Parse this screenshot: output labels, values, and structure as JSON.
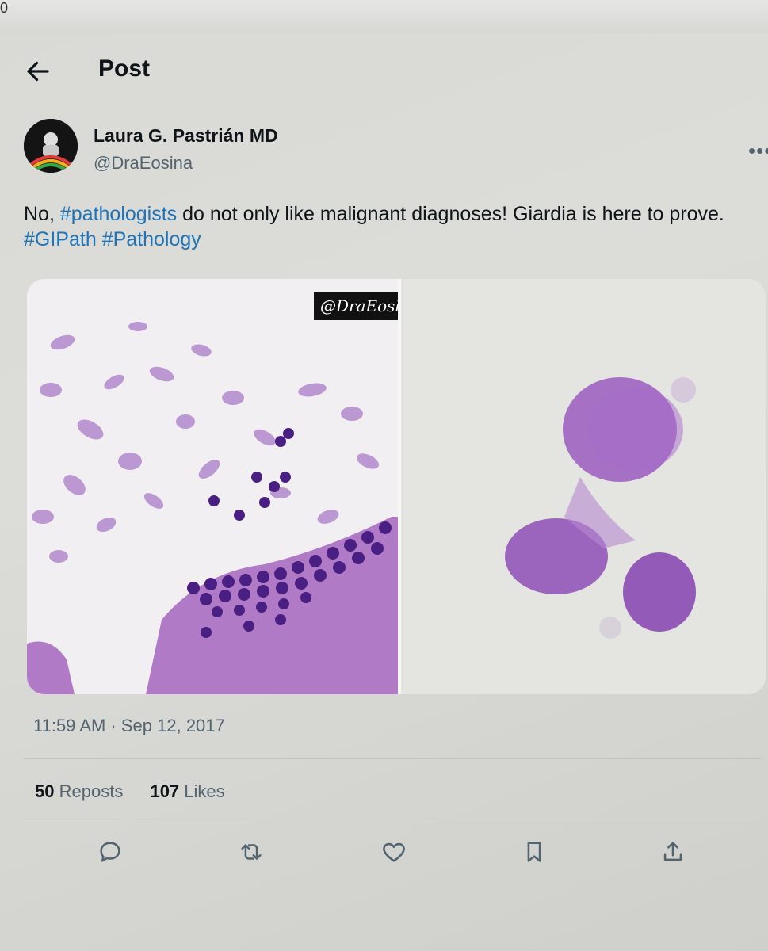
{
  "bezel": {
    "char": "0"
  },
  "header": {
    "title": "Post"
  },
  "post": {
    "author_name": "Laura G. Pastrián MD",
    "author_handle": "@DraEosina",
    "text_parts": [
      {
        "text": "No, ",
        "tag": false
      },
      {
        "text": "#pathologists",
        "tag": true
      },
      {
        "text": " do not only like malignant diagnoses! Giardia is here to prove. ",
        "tag": false
      },
      {
        "text": "#GIPath",
        "tag": true
      },
      {
        "text": " ",
        "tag": false
      },
      {
        "text": "#Pathology",
        "tag": true
      }
    ],
    "image_watermark": "@DraEosina",
    "timestamp": "11:59 AM · Sep 12, 2017",
    "reposts_count": "50",
    "reposts_label": "Reposts",
    "likes_count": "107",
    "likes_label": "Likes"
  },
  "icons": {
    "back": "arrow-left-icon",
    "more": "more-icon",
    "reply": "reply-icon",
    "repost": "repost-icon",
    "like": "heart-icon",
    "bookmark": "bookmark-icon",
    "share": "share-icon"
  },
  "colors": {
    "hashtag": "#1d74b8",
    "text": "#0f1419",
    "secondary": "#536471",
    "stain": "#8b4fb8"
  }
}
